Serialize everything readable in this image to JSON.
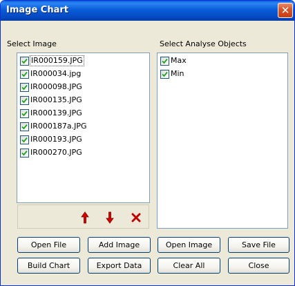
{
  "window": {
    "title": "Image Chart",
    "close_glyph": "✕"
  },
  "images_panel": {
    "label": "Select Image",
    "items": [
      {
        "name": "IR000159.JPG",
        "checked": true
      },
      {
        "name": "IR000034.jpg",
        "checked": true
      },
      {
        "name": "IR000098.JPG",
        "checked": true
      },
      {
        "name": "IR000135.JPG",
        "checked": true
      },
      {
        "name": "IR000139.JPG",
        "checked": true
      },
      {
        "name": "IR000187a.JPG",
        "checked": true
      },
      {
        "name": "IR000193.JPG",
        "checked": true
      },
      {
        "name": "IR000270.JPG",
        "checked": true
      }
    ]
  },
  "objects_panel": {
    "label": "Select Analyse Objects",
    "items": [
      {
        "name": "Max",
        "checked": true
      },
      {
        "name": "Min",
        "checked": true
      }
    ]
  },
  "toolbar": {
    "move_up_icon": "red-up-arrow-icon",
    "move_down_icon": "red-down-arrow-icon",
    "remove_icon": "red-x-icon"
  },
  "buttons": {
    "open_file": "Open File",
    "add_image": "Add Image",
    "open_image": "Open Image",
    "save_file": "Save File",
    "build_chart": "Build Chart",
    "export_data": "Export Data",
    "clear_all": "Clear All",
    "close": "Close"
  },
  "colors": {
    "title_bar": "#0a5cd6",
    "window_bg": "#ece9d8",
    "checkmark": "#21a121",
    "arrow_red": "#d40000"
  }
}
